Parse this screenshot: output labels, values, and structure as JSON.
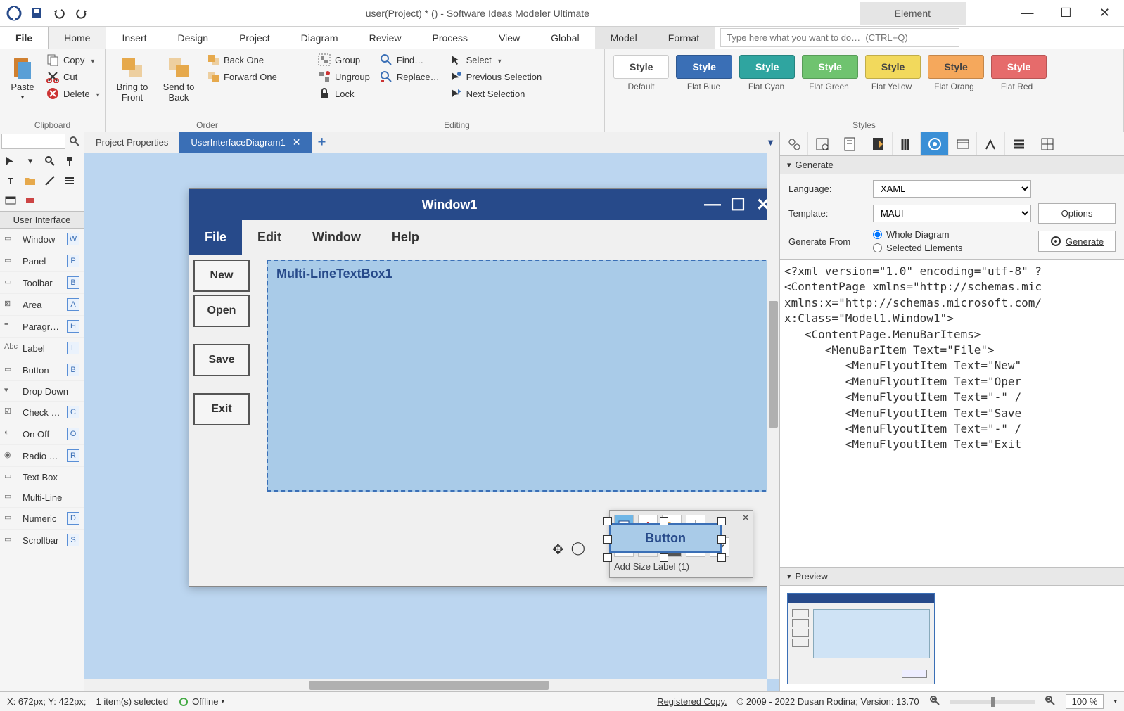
{
  "titlebar": {
    "title": "user(Project) * () - Software Ideas Modeler Ultimate",
    "element_tab": "Element"
  },
  "menus": {
    "file": "File",
    "home": "Home",
    "insert": "Insert",
    "design": "Design",
    "project": "Project",
    "diagram": "Diagram",
    "review": "Review",
    "process": "Process",
    "view": "View",
    "global": "Global",
    "model": "Model",
    "format": "Format",
    "search_placeholder": "Type here what you want to do…  (CTRL+Q)"
  },
  "ribbon": {
    "clipboard": {
      "label": "Clipboard",
      "paste": "Paste",
      "copy": "Copy",
      "cut": "Cut",
      "delete": "Delete"
    },
    "order": {
      "label": "Order",
      "bring_front": "Bring to\nFront",
      "send_back": "Send to\nBack",
      "back_one": "Back One",
      "forward_one": "Forward One"
    },
    "editing": {
      "label": "Editing",
      "group": "Group",
      "ungroup": "Ungroup",
      "lock": "Lock",
      "find": "Find…",
      "replace": "Replace…",
      "select": "Select",
      "prev_sel": "Previous Selection",
      "next_sel": "Next Selection"
    },
    "styles": {
      "label": "Styles",
      "swatches": [
        {
          "name": "Default",
          "label": "Style",
          "bg": "#ffffff",
          "fg": "#444"
        },
        {
          "name": "Flat Blue",
          "label": "Style",
          "bg": "#3a6fb6",
          "fg": "#fff"
        },
        {
          "name": "Flat Cyan",
          "label": "Style",
          "bg": "#2fa5a0",
          "fg": "#fff"
        },
        {
          "name": "Flat Green",
          "label": "Style",
          "bg": "#6fc36f",
          "fg": "#fff"
        },
        {
          "name": "Flat Yellow",
          "label": "Style",
          "bg": "#f2d95c",
          "fg": "#444"
        },
        {
          "name": "Flat Orang",
          "label": "Style",
          "bg": "#f5a85c",
          "fg": "#444"
        },
        {
          "name": "Flat Red",
          "label": "Style",
          "bg": "#e66b6b",
          "fg": "#fff"
        }
      ]
    }
  },
  "doc_tabs": {
    "inactive": "Project Properties",
    "active": "UserInterfaceDiagram1"
  },
  "toolbox": {
    "header": "User Interface",
    "items": [
      {
        "label": "Window",
        "key": "W"
      },
      {
        "label": "Panel",
        "key": "P"
      },
      {
        "label": "Toolbar",
        "key": "B"
      },
      {
        "label": "Area",
        "key": "A"
      },
      {
        "label": "Paragraph",
        "key": "H"
      },
      {
        "label": "Label",
        "key": "L"
      },
      {
        "label": "Button",
        "key": "B"
      },
      {
        "label": "Drop Down",
        "key": ""
      },
      {
        "label": "Check Box",
        "key": "C"
      },
      {
        "label": "On Off",
        "key": "O"
      },
      {
        "label": "Radio Button",
        "key": "R"
      },
      {
        "label": "Text Box",
        "key": ""
      },
      {
        "label": "Multi-Line",
        "key": ""
      },
      {
        "label": "Numeric",
        "key": "D"
      },
      {
        "label": "Scrollbar",
        "key": "S"
      }
    ]
  },
  "mock": {
    "window_title": "Window1",
    "menubar": [
      "File",
      "Edit",
      "Window",
      "Help"
    ],
    "side_items": [
      "New",
      "Open",
      "Save",
      "Exit"
    ],
    "textbox_text": "Multi-LineTextBox1",
    "button_text": "Button",
    "ctx_label": "Add Size Label (1)"
  },
  "generate": {
    "header": "Generate",
    "language_label": "Language:",
    "language_value": "XAML",
    "template_label": "Template:",
    "template_value": "MAUI",
    "from_label": "Generate From",
    "opt_whole": "Whole Diagram",
    "opt_selected": "Selected Elements",
    "options_btn": "Options",
    "generate_btn": "Generate",
    "code": "<?xml version=\"1.0\" encoding=\"utf-8\" ?\n<ContentPage xmlns=\"http://schemas.mic\nxmlns:x=\"http://schemas.microsoft.com/\nx:Class=\"Model1.Window1\">\n   <ContentPage.MenuBarItems>\n      <MenuBarItem Text=\"File\">\n         <MenuFlyoutItem Text=\"New\"\n         <MenuFlyoutItem Text=\"Oper\n         <MenuFlyoutItem Text=\"-\" /\n         <MenuFlyoutItem Text=\"Save\n         <MenuFlyoutItem Text=\"-\" /\n         <MenuFlyoutItem Text=\"Exit"
  },
  "preview": {
    "header": "Preview"
  },
  "status": {
    "coords": "X: 672px; Y: 422px;",
    "selection": "1 item(s) selected",
    "offline": "Offline",
    "registered": "Registered Copy.",
    "copyright": "© 2009 - 2022 Dusan Rodina; Version: 13.70",
    "zoom": "100 %"
  }
}
